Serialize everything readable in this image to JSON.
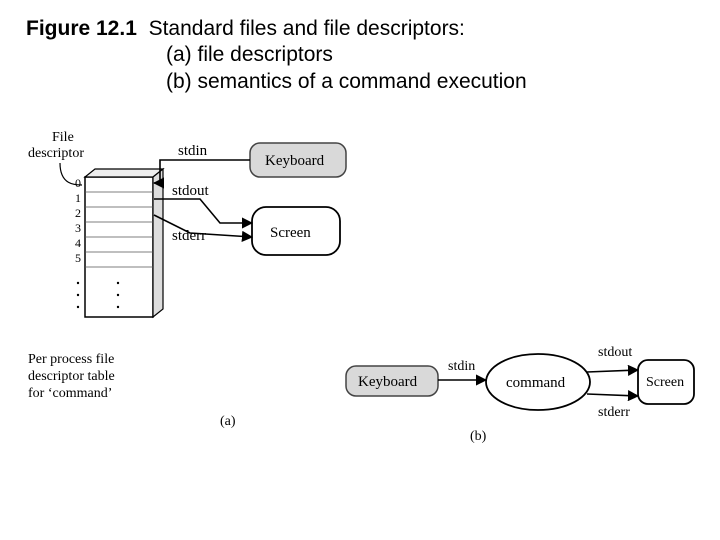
{
  "caption": {
    "label": "Figure 12.1",
    "title": "Standard files and file descriptors:",
    "line_a": "(a) file descriptors",
    "line_b": "(b) semantics of a command execution"
  },
  "diagram_a": {
    "header": "File\ndescriptor",
    "indices": [
      "0",
      "1",
      "2",
      "3",
      "4",
      "5"
    ],
    "streams": {
      "stdin": "stdin",
      "stdout": "stdout",
      "stderr": "stderr"
    },
    "devices": {
      "keyboard": "Keyboard",
      "screen": "Screen"
    },
    "footer": "Per process file\ndescriptor table\nfor 'command'",
    "sub": "(a)"
  },
  "diagram_b": {
    "keyboard": "Keyboard",
    "command": "command",
    "screen": "Screen",
    "streams": {
      "stdin": "stdin",
      "stdout": "stdout",
      "stderr": "stderr"
    },
    "sub": "(b)"
  }
}
